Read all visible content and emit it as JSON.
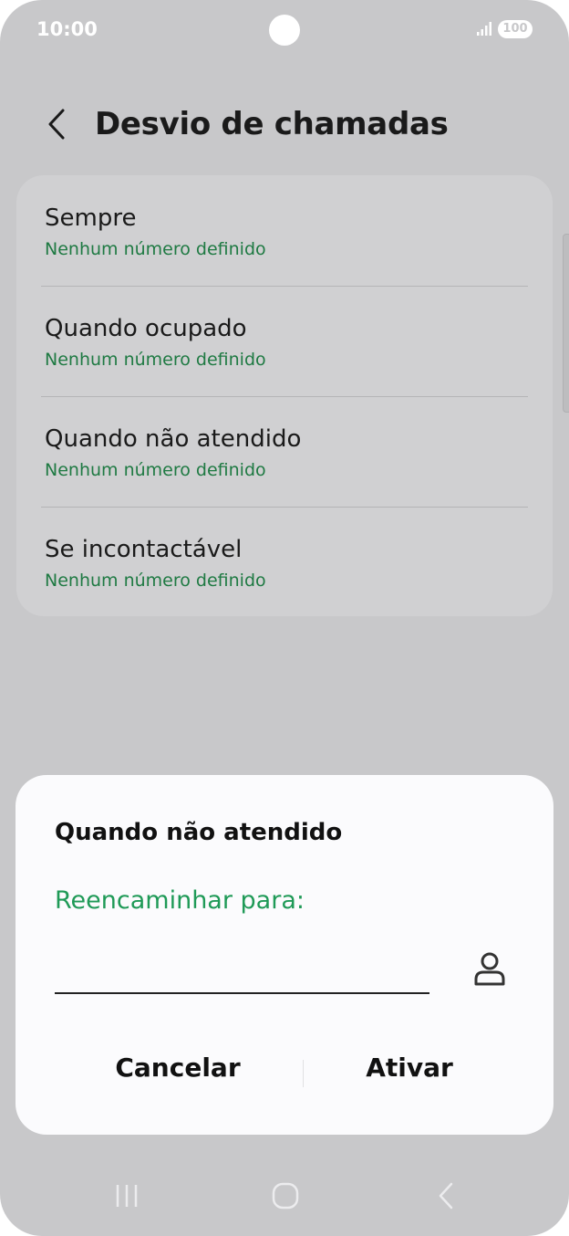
{
  "status_bar": {
    "time": "10:00",
    "battery": "100",
    "icons": [
      "signal-icon",
      "battery-icon"
    ]
  },
  "header": {
    "title": "Desvio de chamadas",
    "back_icon": "chevron-left-icon"
  },
  "forwarding_options": [
    {
      "title": "Sempre",
      "subtitle": "Nenhum número definido"
    },
    {
      "title": "Quando ocupado",
      "subtitle": "Nenhum número definido"
    },
    {
      "title": "Quando não atendido",
      "subtitle": "Nenhum número definido"
    },
    {
      "title": "Se incontactável",
      "subtitle": "Nenhum número definido"
    }
  ],
  "dialog": {
    "title": "Quando não atendido",
    "label": "Reencaminhar para:",
    "input_value": "",
    "contact_icon": "person-icon",
    "cancel_label": "Cancelar",
    "activate_label": "Ativar"
  },
  "nav_bar": {
    "icons": [
      "recent-apps-icon",
      "home-icon",
      "back-icon"
    ]
  },
  "colors": {
    "accent_green": "#1f9a57",
    "subtitle_green": "#1f7a43",
    "dim_background": "#c8c8ca",
    "dialog_background": "#fbfbfd"
  }
}
